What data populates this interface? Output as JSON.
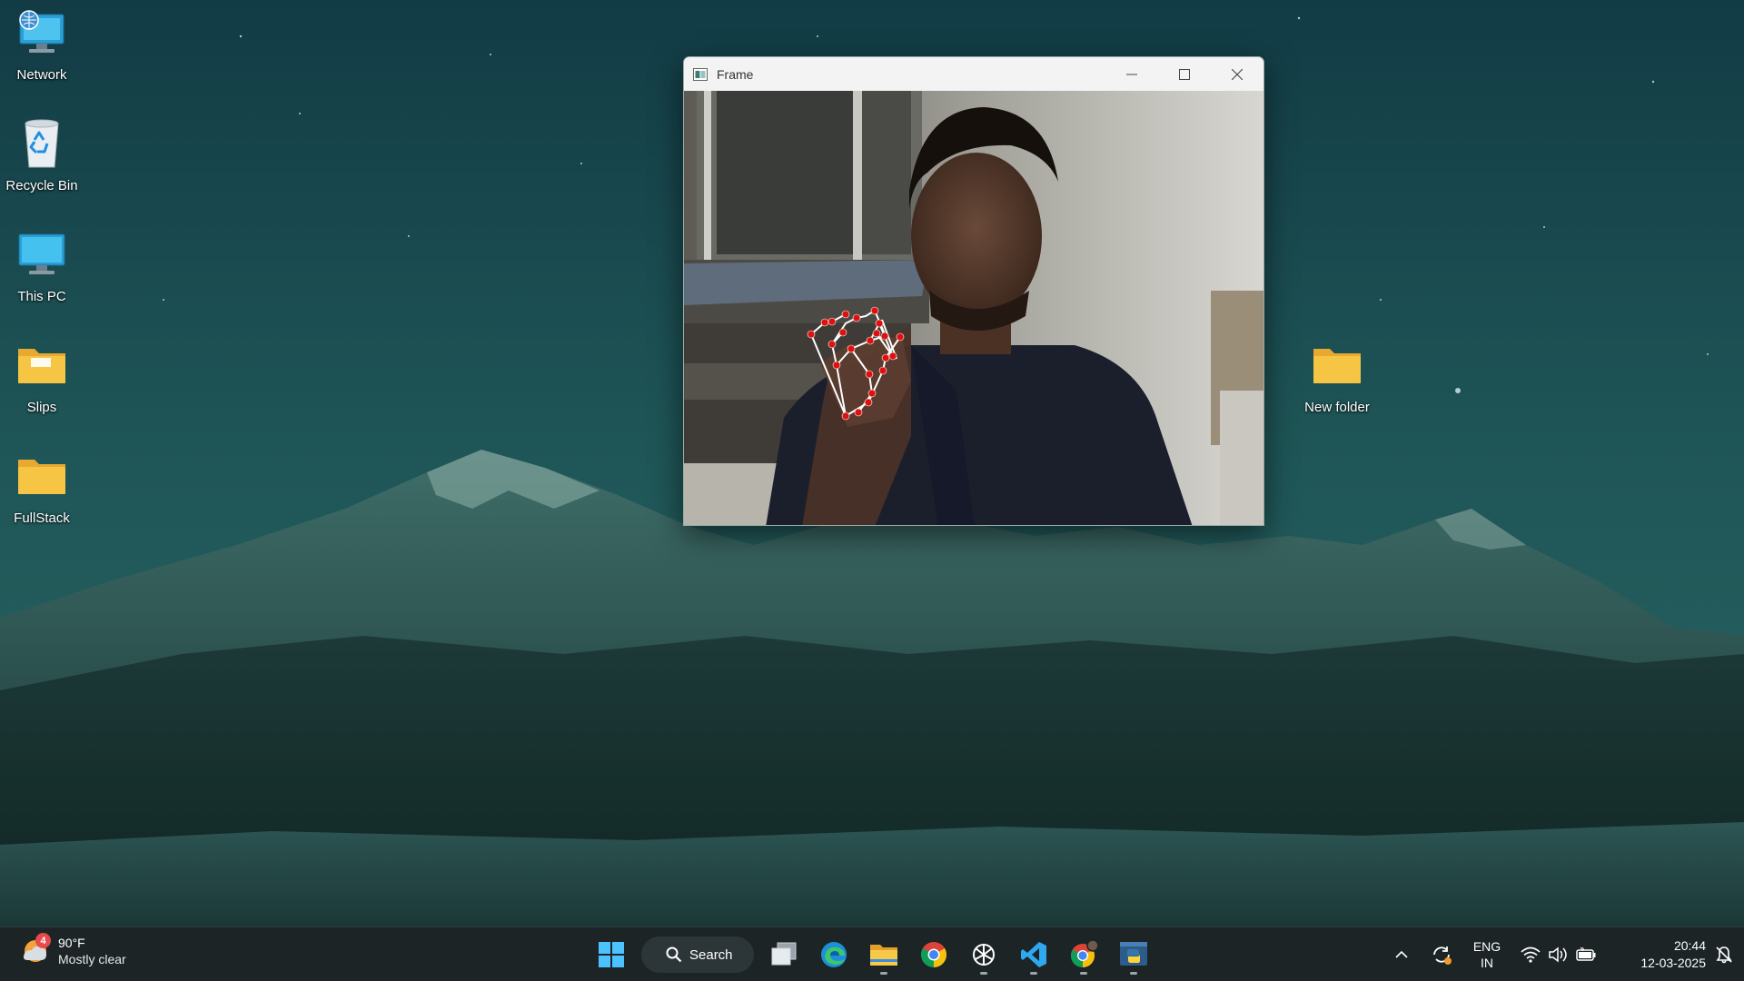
{
  "desktop": {
    "icons": [
      {
        "label": "Network",
        "icon": "network-icon"
      },
      {
        "label": "Recycle Bin",
        "icon": "recycle-bin-icon"
      },
      {
        "label": "This PC",
        "icon": "this-pc-icon"
      },
      {
        "label": "Slips",
        "icon": "folder-icon"
      },
      {
        "label": "FullStack",
        "icon": "folder-icon"
      },
      {
        "label": "New folder",
        "icon": "folder-icon"
      }
    ]
  },
  "window": {
    "title": "Frame",
    "controls": [
      "minimize",
      "maximize",
      "close"
    ]
  },
  "taskbar": {
    "weather": {
      "temp": "90°F",
      "desc": "Mostly clear",
      "badge": "4"
    },
    "search_label": "Search",
    "apps": [
      "start-icon",
      "task-view-icon",
      "edge-icon",
      "file-explorer-icon",
      "chrome-icon",
      "chatgpt-icon",
      "vscode-icon",
      "chrome-profile-icon",
      "python-icon"
    ],
    "tray": {
      "lang_line1": "ENG",
      "lang_line2": "IN",
      "time": "20:44",
      "date": "12-03-2025"
    }
  },
  "colors": {
    "taskbar_bg": "#1c2426",
    "folder_yellow": "#f6c544",
    "landmark_red": "#e01010"
  }
}
